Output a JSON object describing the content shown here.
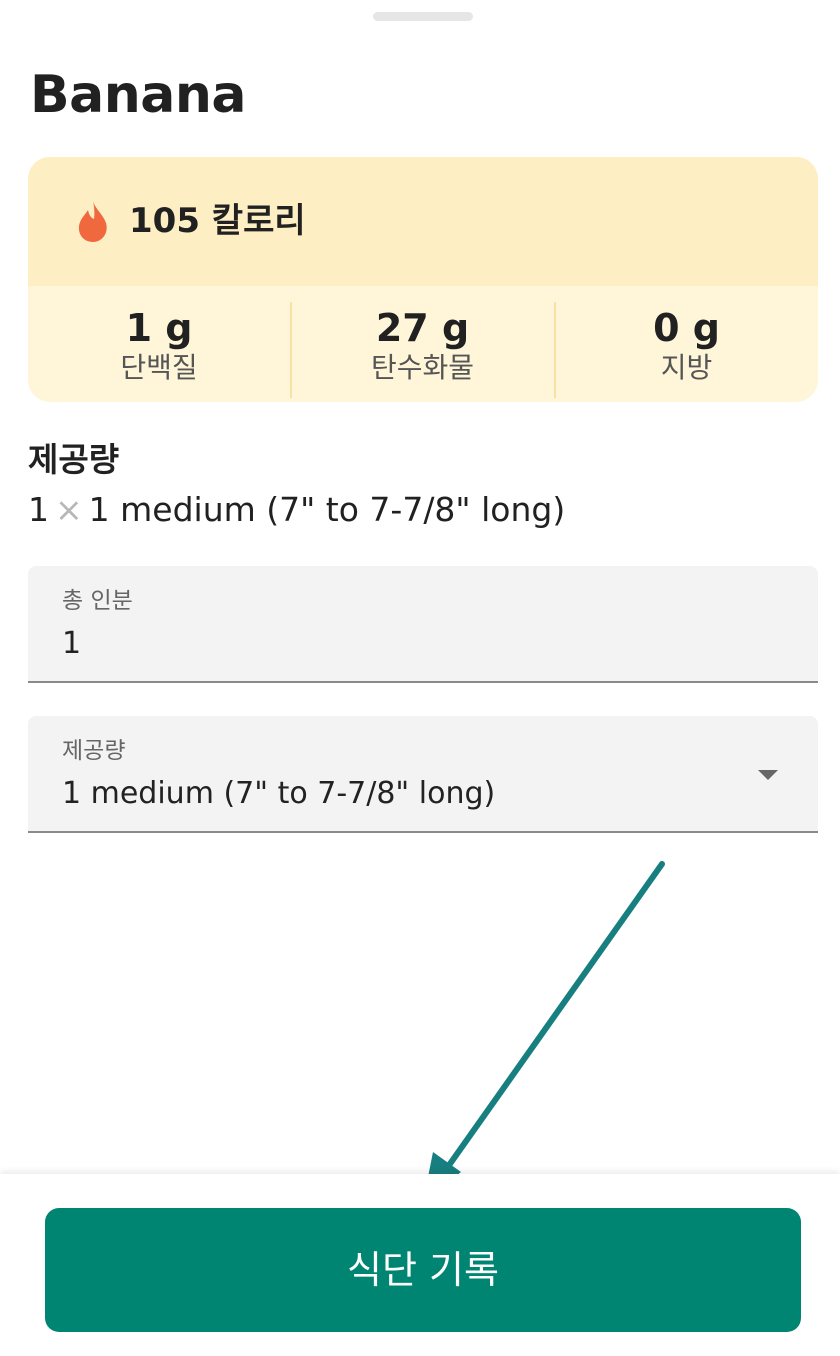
{
  "food": {
    "name": "Banana"
  },
  "nutrition": {
    "calories_text": "105 칼로리",
    "macros": [
      {
        "value": "1 g",
        "label": "단백질"
      },
      {
        "value": "27 g",
        "label": "탄수화물"
      },
      {
        "value": "0 g",
        "label": "지방"
      }
    ]
  },
  "serving": {
    "heading": "제공량",
    "quantity": "1",
    "times": "×",
    "description": "1 medium (7\" to 7-7/8\" long)"
  },
  "form": {
    "servings_label": "총 인분",
    "servings_value": "1",
    "size_label": "제공량",
    "size_value": "1 medium (7\" to 7-7/8\" long)"
  },
  "actions": {
    "log_label": "식단 기록"
  },
  "icons": {
    "flame": "flame-icon",
    "times": "times-icon",
    "dropdown": "chevron-down-icon",
    "arrow": "arrow-annotation"
  },
  "colors": {
    "accent": "#008573",
    "flame": "#f0683d",
    "calorie_bg": "#fdefc3",
    "macro_bg": "#fff6da",
    "arrow": "#177f80"
  }
}
